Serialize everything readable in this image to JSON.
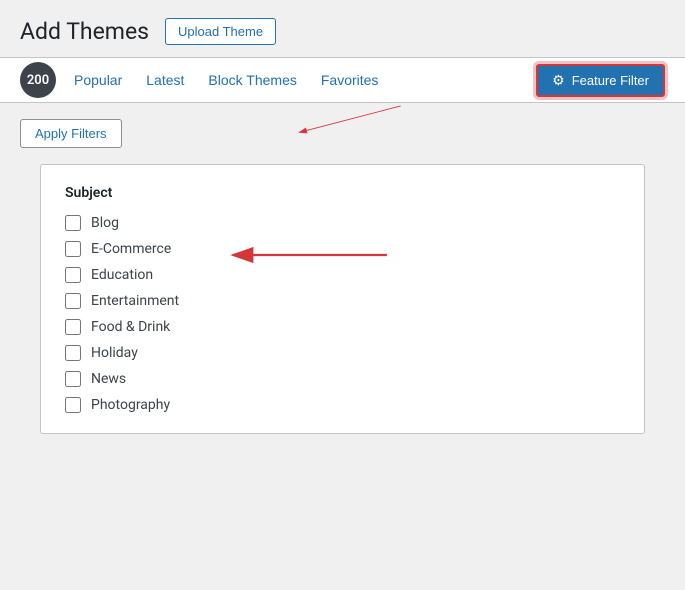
{
  "header": {
    "title": "Add Themes",
    "upload_button_label": "Upload Theme"
  },
  "nav": {
    "count": "200",
    "tabs": [
      {
        "label": "Popular",
        "id": "popular"
      },
      {
        "label": "Latest",
        "id": "latest"
      },
      {
        "label": "Block Themes",
        "id": "block-themes"
      },
      {
        "label": "Favorites",
        "id": "favorites"
      }
    ],
    "feature_filter_label": "Feature Filter"
  },
  "apply_filters": {
    "label": "Apply Filters"
  },
  "filter": {
    "section_title": "Subject",
    "items": [
      {
        "label": "Blog",
        "checked": false
      },
      {
        "label": "E-Commerce",
        "checked": false
      },
      {
        "label": "Education",
        "checked": false
      },
      {
        "label": "Entertainment",
        "checked": false
      },
      {
        "label": "Food & Drink",
        "checked": false
      },
      {
        "label": "Holiday",
        "checked": false
      },
      {
        "label": "News",
        "checked": false
      },
      {
        "label": "Photography",
        "checked": false
      }
    ]
  },
  "colors": {
    "accent_blue": "#2271b1",
    "danger_red": "#d63638"
  }
}
